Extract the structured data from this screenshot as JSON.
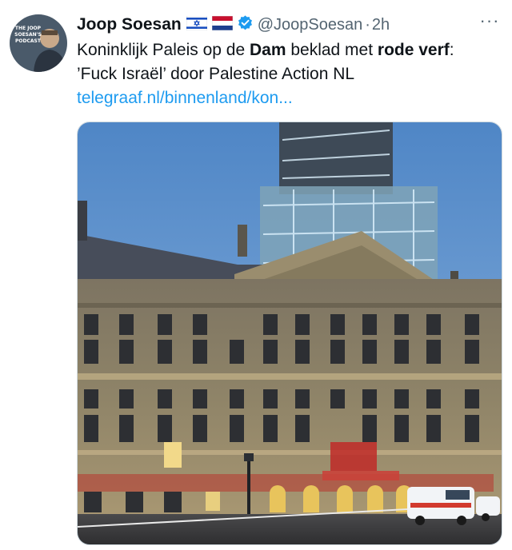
{
  "tweet": {
    "author": {
      "name": "Joop Soesan",
      "flags": [
        "israel-flag-icon",
        "netherlands-flag-icon"
      ],
      "handle": "@JoopSoesan",
      "separator": "·",
      "time": "2h",
      "avatar_text": "THE JOOP SOESAN'S PODCAST"
    },
    "more_label": "···",
    "text_parts": {
      "p1": "Koninklijk Paleis op de ",
      "b1": "Dam",
      "p2": " beklad met ",
      "b2": "rode verf",
      "p3": ": ’Fuck Israël’ door Palestine Action NL"
    },
    "link": "telegraaf.nl/binnenland/kon...",
    "media": {
      "icon": "photo-royal-palace-dam"
    }
  },
  "colors": {
    "text": "#0f1419",
    "secondary": "#536471",
    "link": "#1d9bf0",
    "verified": "#1d9bf0"
  }
}
